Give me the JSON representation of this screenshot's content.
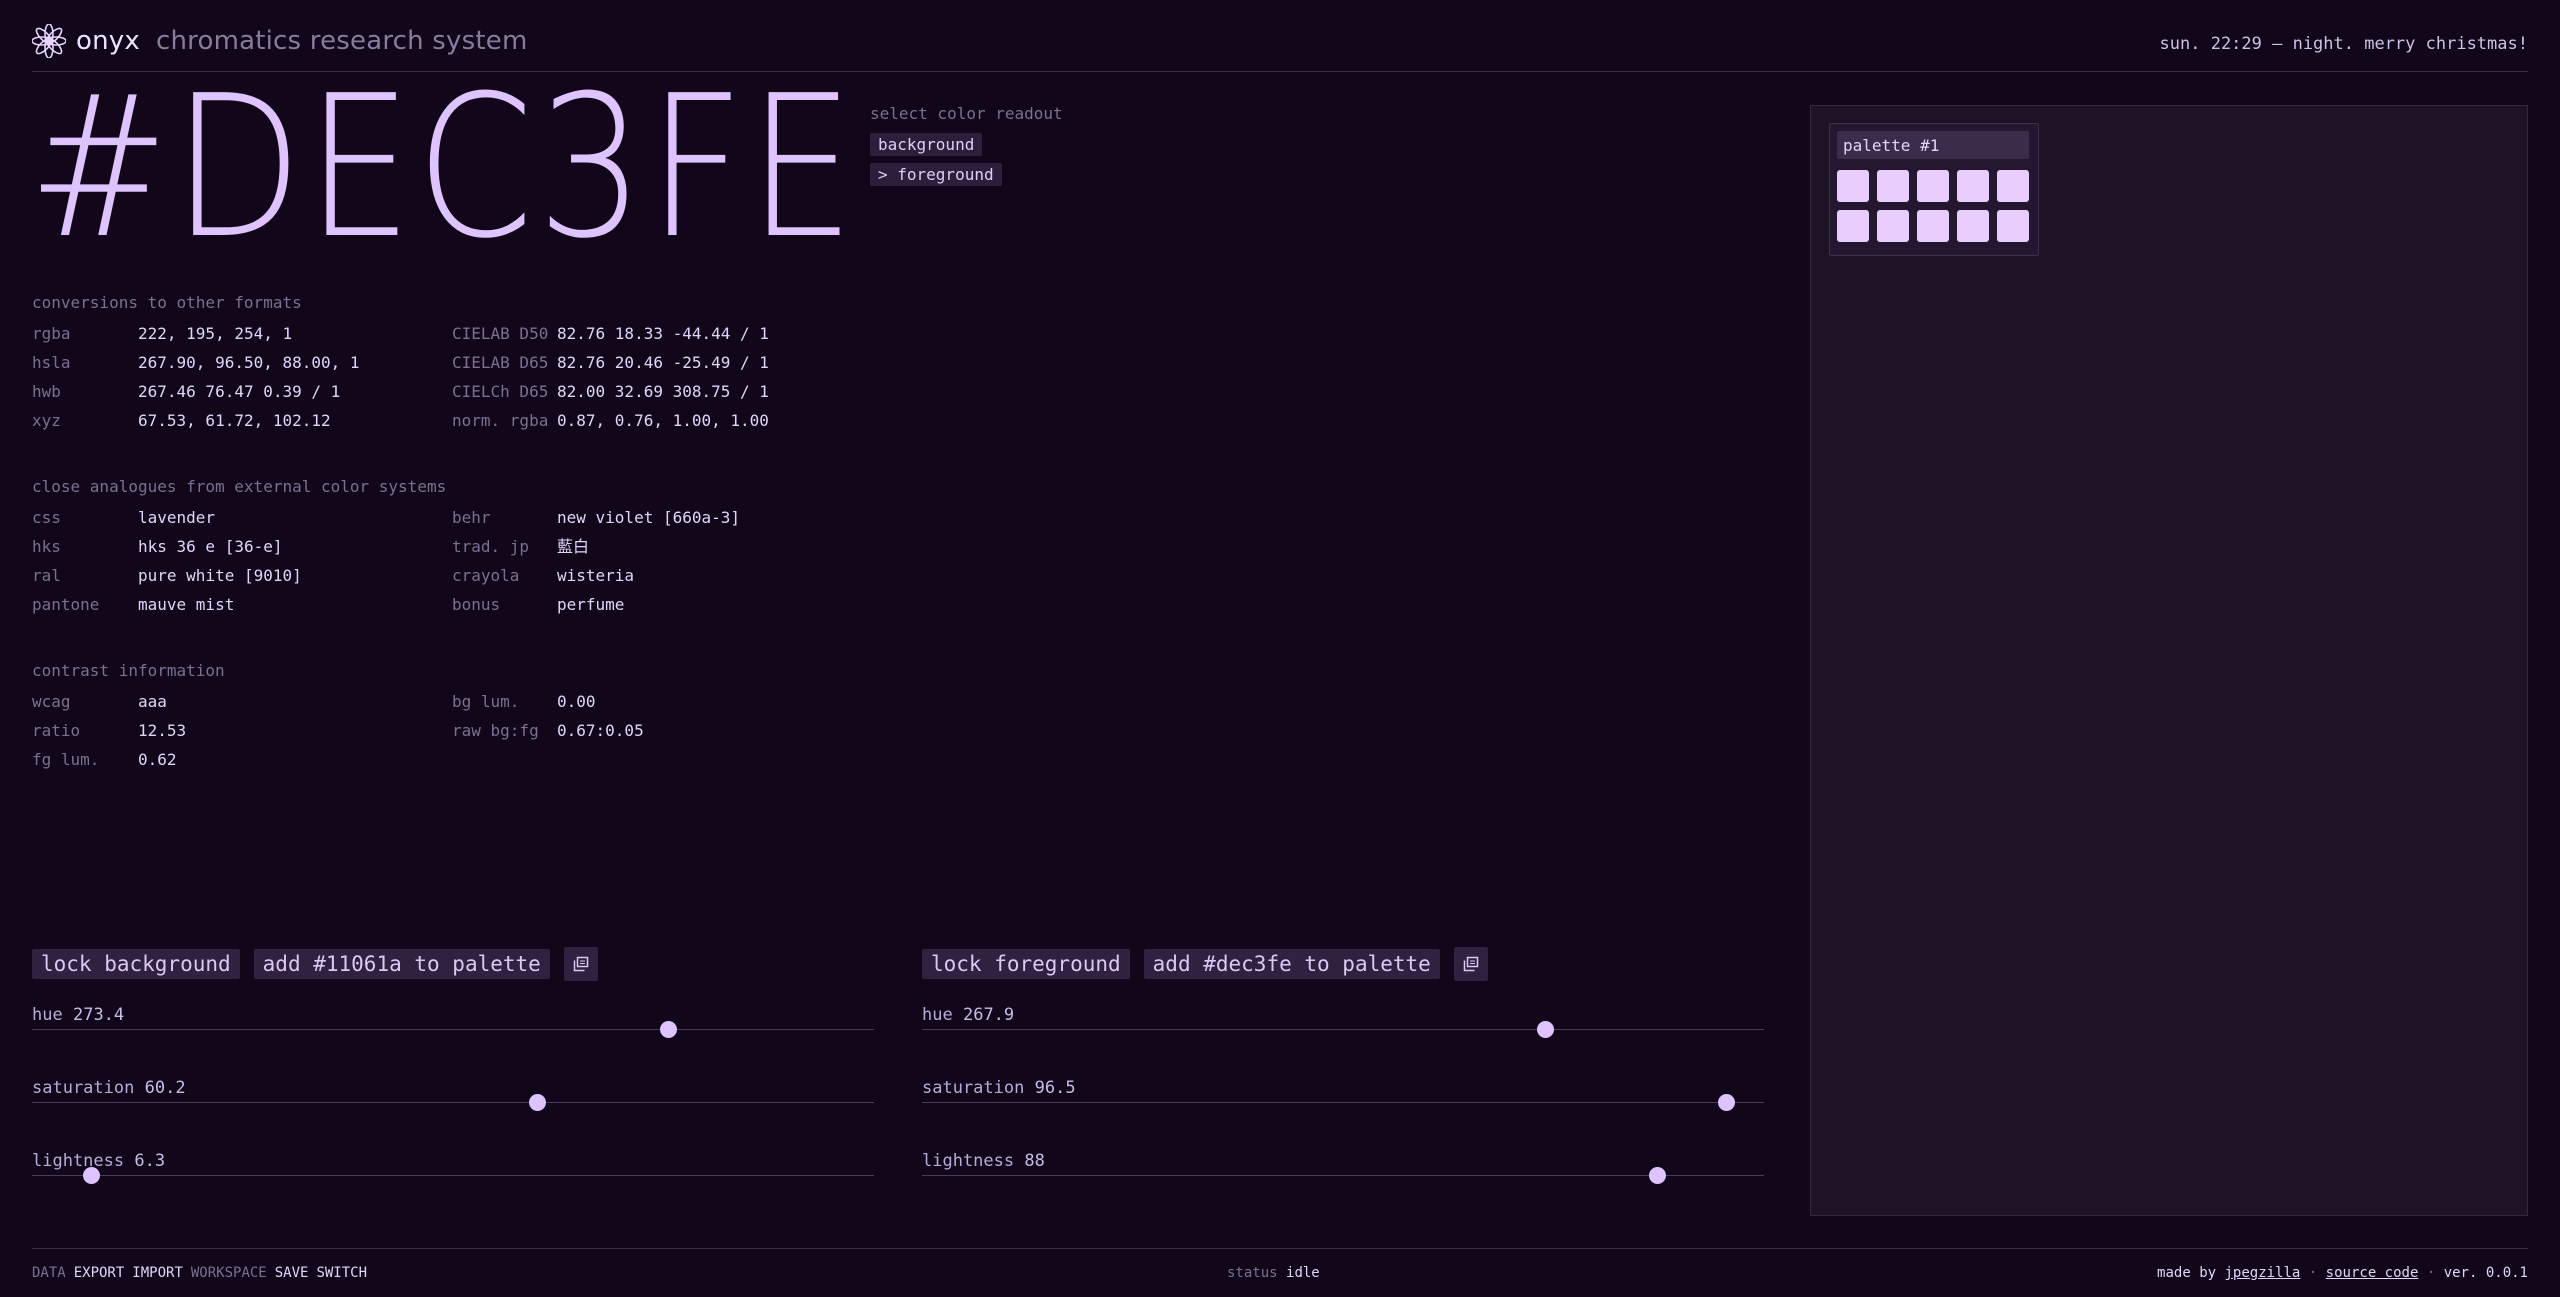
{
  "header": {
    "brand_name": "onyx",
    "brand_subtitle": "chromatics research system",
    "status": "sun. 22:29 — night. merry christmas!"
  },
  "hex_display": "#DEC3FE",
  "readout": {
    "label": "select color readout",
    "options": [
      "background",
      "> foreground"
    ]
  },
  "conversions": {
    "title": "conversions to other formats",
    "left": [
      {
        "k": "rgba",
        "v": "222, 195, 254, 1"
      },
      {
        "k": "hsla",
        "v": "267.90, 96.50, 88.00, 1"
      },
      {
        "k": "hwb",
        "v": "267.46 76.47 0.39 / 1"
      },
      {
        "k": "xyz",
        "v": "67.53, 61.72, 102.12"
      }
    ],
    "right": [
      {
        "k": "CIELAB D50",
        "v": "82.76 18.33 -44.44 / 1"
      },
      {
        "k": "CIELAB D65",
        "v": "82.76 20.46 -25.49 / 1"
      },
      {
        "k": "CIELCh D65",
        "v": "82.00 32.69 308.75 / 1"
      },
      {
        "k": "norm. rgba",
        "v": "0.87, 0.76, 1.00, 1.00"
      }
    ]
  },
  "analogues": {
    "title": "close analogues from external color systems",
    "left": [
      {
        "k": "css",
        "v": "lavender"
      },
      {
        "k": "hks",
        "v": "hks 36 e [36-e]"
      },
      {
        "k": "ral",
        "v": "pure white [9010]"
      },
      {
        "k": "pantone",
        "v": "mauve mist"
      }
    ],
    "right": [
      {
        "k": "behr",
        "v": "new violet [660a-3]"
      },
      {
        "k": "trad. jp",
        "v": "藍白"
      },
      {
        "k": "crayola",
        "v": "wisteria"
      },
      {
        "k": "bonus",
        "v": "perfume"
      }
    ]
  },
  "contrast": {
    "title": "contrast information",
    "left": [
      {
        "k": "wcag",
        "v": "aaa"
      },
      {
        "k": "ratio",
        "v": "12.53"
      },
      {
        "k": "fg lum.",
        "v": "0.62"
      }
    ],
    "right": [
      {
        "k": "bg lum.",
        "v": "0.00"
      },
      {
        "k": "raw bg:fg",
        "v": "0.67:0.05"
      }
    ]
  },
  "background_controls": {
    "lock_label": "lock background",
    "add_label": "add #11061a to palette",
    "sliders": [
      {
        "name": "hue",
        "value": "273.4",
        "fraction": 0.755
      },
      {
        "name": "saturation",
        "value": "60.2",
        "fraction": 0.6
      },
      {
        "name": "lightness",
        "value": "6.3",
        "fraction": 0.07
      }
    ]
  },
  "foreground_controls": {
    "lock_label": "lock foreground",
    "add_label": "add #dec3fe to palette",
    "sliders": [
      {
        "name": "hue",
        "value": "267.9",
        "fraction": 0.74
      },
      {
        "name": "saturation",
        "value": "96.5",
        "fraction": 0.955
      },
      {
        "name": "lightness",
        "value": "88",
        "fraction": 0.873
      }
    ]
  },
  "palette": {
    "name": "palette #1",
    "swatch_color": "#e8cdfd",
    "swatch_count": 10
  },
  "footer": {
    "data_label": "DATA",
    "export_label": "EXPORT",
    "import_label": "IMPORT",
    "workspace_label": "WORKSPACE",
    "save_label": "SAVE",
    "switch_label": "SWITCH",
    "status_label": "status",
    "status_value": "idle",
    "made_by": "made by",
    "author": "jpegzilla",
    "sep1": "·",
    "source_label": "source code",
    "sep2": "·",
    "version": "ver. 0.0.1"
  },
  "colors": {
    "background": "#11061a",
    "foreground": "#dec3fe"
  }
}
